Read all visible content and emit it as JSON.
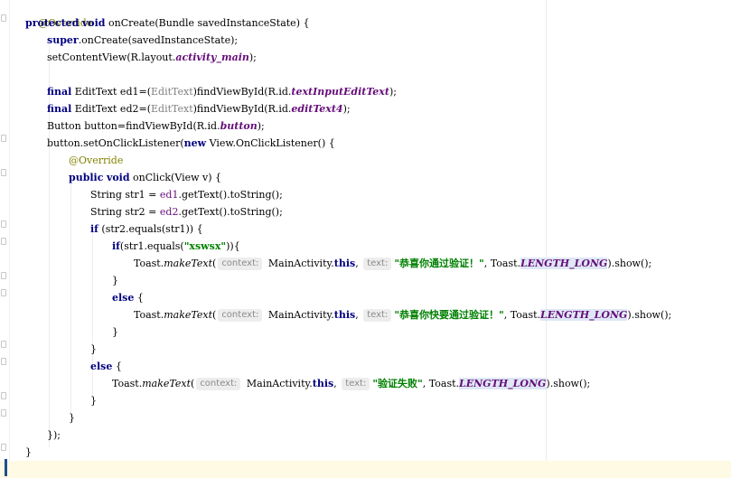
{
  "code": {
    "override_1": "@Override",
    "l2_protected": "protected",
    "l2_void": "void",
    "l2_rest": " onCreate(Bundle savedInstanceState) {",
    "l3_super": "super",
    "l3_rest": ".onCreate(savedInstanceState);",
    "l4_pre": "setContentView(R.layout.",
    "l4_field": "activity_main",
    "l4_post": ");",
    "final_kw": "final",
    "l5_pre": " EditText ed1=(",
    "cast_edittext": "EditText",
    "l5_mid": ")findViewById(R.id.",
    "l5_field": "textInputEditText",
    "l5_post": ");",
    "l6_pre": " EditText ed2=(",
    "l6_mid": ")findViewById(R.id.",
    "l6_field": "editText4",
    "l6_post": ");",
    "l7_pre": "Button button=findViewById(R.id.",
    "l7_field": "button",
    "l7_post": ");",
    "l8_pre": "button.setOnClickListener(",
    "new_kw": "new",
    "l8_post": " View.OnClickListener() {",
    "override_2": "@Override",
    "public_kw": "public",
    "void_kw": "void",
    "l10_rest": " onClick(View v) {",
    "l11_pre": "String str1 = ",
    "l11_var": "ed1",
    "l11_post": ".getText().toString();",
    "l12_pre": "String str2 = ",
    "l12_var": "ed2",
    "l12_post": ".getText().toString();",
    "if_kw": "if",
    "l13_rest": " (str2.equals(str1)) {",
    "l14_rest": "(str1.equals(",
    "l14_str": "\"xswsx\"",
    "l14_post": ")){",
    "toast_pre": "Toast.",
    "make_text": "makeText",
    "open_paren": "(",
    "hint_context": "context:",
    "main_activity": " MainActivity.",
    "this_kw": "this",
    "comma": ",",
    "hint_text": "text:",
    "msg_success": "\"恭喜你通过验证！\"",
    "msg_fast": "\"恭喜你快要通过验证！\"",
    "msg_fail": "\"验证失败\"",
    "toast_mid": ", Toast.",
    "length_long": "LENGTH_LONG",
    "show_post": ").show();",
    "close_brace": "}",
    "else_kw": "else",
    "else_post": " {",
    "close_listener": "});",
    "close_class": "}"
  },
  "colors": {
    "keyword": "#000080",
    "annotation": "#808000",
    "string": "#008000",
    "field": "#660e7a",
    "hint_background": "#ededed",
    "current_line": "#fffae3",
    "caret": "#1d4f91"
  }
}
